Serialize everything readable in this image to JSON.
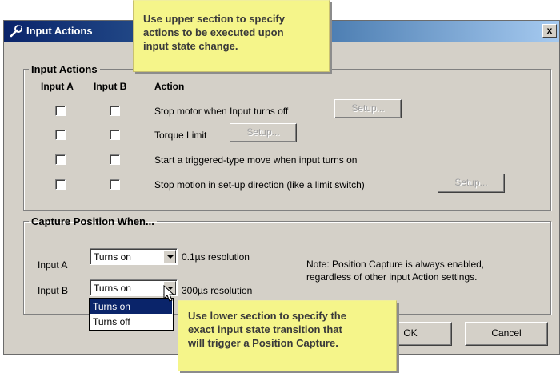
{
  "window": {
    "title": "Input Actions",
    "close_label": "x"
  },
  "callouts": {
    "top": [
      "Use upper section to specify",
      "actions to be executed upon",
      "input state change."
    ],
    "bottom": [
      "Use lower section to specify the",
      "exact input state transition  that",
      "will  trigger a Position Capture."
    ]
  },
  "input_actions": {
    "legend": "Input Actions",
    "col_a": "Input A",
    "col_b": "Input B",
    "col_action": "Action",
    "rows": [
      {
        "label": "Stop motor when Input turns off",
        "setup": "Setup...",
        "input_a": false,
        "input_b": false
      },
      {
        "label": "Torque Limit",
        "setup": "Setup...",
        "input_a": false,
        "input_b": false
      },
      {
        "label": "Start a triggered-type move when input turns on",
        "input_a": false,
        "input_b": false
      },
      {
        "label": "Stop motion in set-up direction (like a limit switch)",
        "setup": "Setup...",
        "input_a": false,
        "input_b": false
      }
    ]
  },
  "capture": {
    "legend": "Capture Position When...",
    "input_a": {
      "label": "Input A",
      "value": "Turns on",
      "resolution": "0.1µs resolution"
    },
    "input_b": {
      "label": "Input B",
      "value": "Turns on",
      "resolution": "300µs resolution"
    },
    "note": [
      "Note: Position Capture is always enabled,",
      "regardless of other input Action settings."
    ],
    "dropdown_options": [
      "Turns on",
      "Turns off"
    ],
    "dropdown_selected": "Turns on"
  },
  "buttons": {
    "ok": "OK",
    "cancel": "Cancel"
  },
  "colors": {
    "title_start": "#0a246a",
    "title_end": "#a6caf0",
    "dialog": "#d4d0c8",
    "callout": "#f5f58a",
    "selection": "#0a246a"
  }
}
